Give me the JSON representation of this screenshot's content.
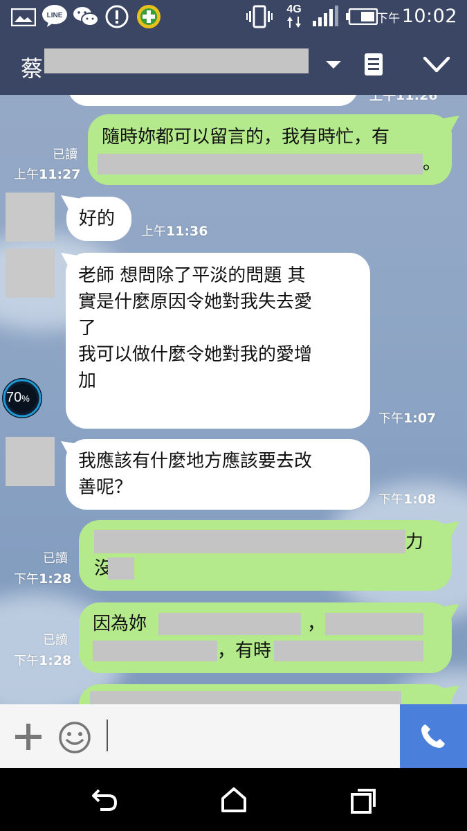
{
  "status_bar": {
    "icons": [
      "gallery-icon",
      "line-app-icon",
      "wechat-icon",
      "alert-icon",
      "plus-app-icon",
      "vibrate-icon",
      "network-4g-icon",
      "signal-icon",
      "battery-icon"
    ],
    "line_label": "LINE",
    "network_label": "4G",
    "time_prefix": "下午",
    "time": "10:02"
  },
  "header": {
    "title_visible": "蔡",
    "icons": [
      "dropdown-arrow-icon",
      "notes-icon",
      "collapse-chevron-icon"
    ]
  },
  "messages": [
    {
      "id": "m1",
      "side": "mine",
      "text_line1": "隨時妳都可以留言的，我有時忙，有",
      "text_line2_end": "。",
      "read": "已讀",
      "time_prefix": "上午",
      "time": "11:27"
    },
    {
      "id": "m2",
      "side": "theirs",
      "text": "好的",
      "time_prefix": "上午",
      "time": "11:36"
    },
    {
      "id": "m3",
      "side": "theirs",
      "lines": [
        "老師 想問除了平淡的問題 其",
        "實是什麼原因令她對我失去愛",
        "了",
        "我可以做什麼令她對我的愛增",
        "加"
      ],
      "time_prefix": "下午",
      "time": "1:07"
    },
    {
      "id": "m4",
      "side": "theirs",
      "lines": [
        "我應該有什麼地方應該要去改",
        "善呢？"
      ],
      "time_prefix": "下午",
      "time": "1:08"
    },
    {
      "id": "m5",
      "side": "mine",
      "text_line1_end": "力",
      "text_line2_start": "沒",
      "read": "已讀",
      "time_prefix": "下午",
      "time": "1:28"
    },
    {
      "id": "m6",
      "side": "mine",
      "text_line1_start": "因為妳",
      "text_line1_mid": "，",
      "text_line2_mid": "，有時",
      "read": "已讀",
      "time_prefix": "下午",
      "time": "1:28"
    }
  ],
  "overlay_badge": {
    "value": "70",
    "unit": "%"
  },
  "colors": {
    "header_bg": "#3a4663",
    "my_bubble": "#b4e98c",
    "their_bubble": "#ffffff",
    "call_button": "#4a7fdb"
  }
}
